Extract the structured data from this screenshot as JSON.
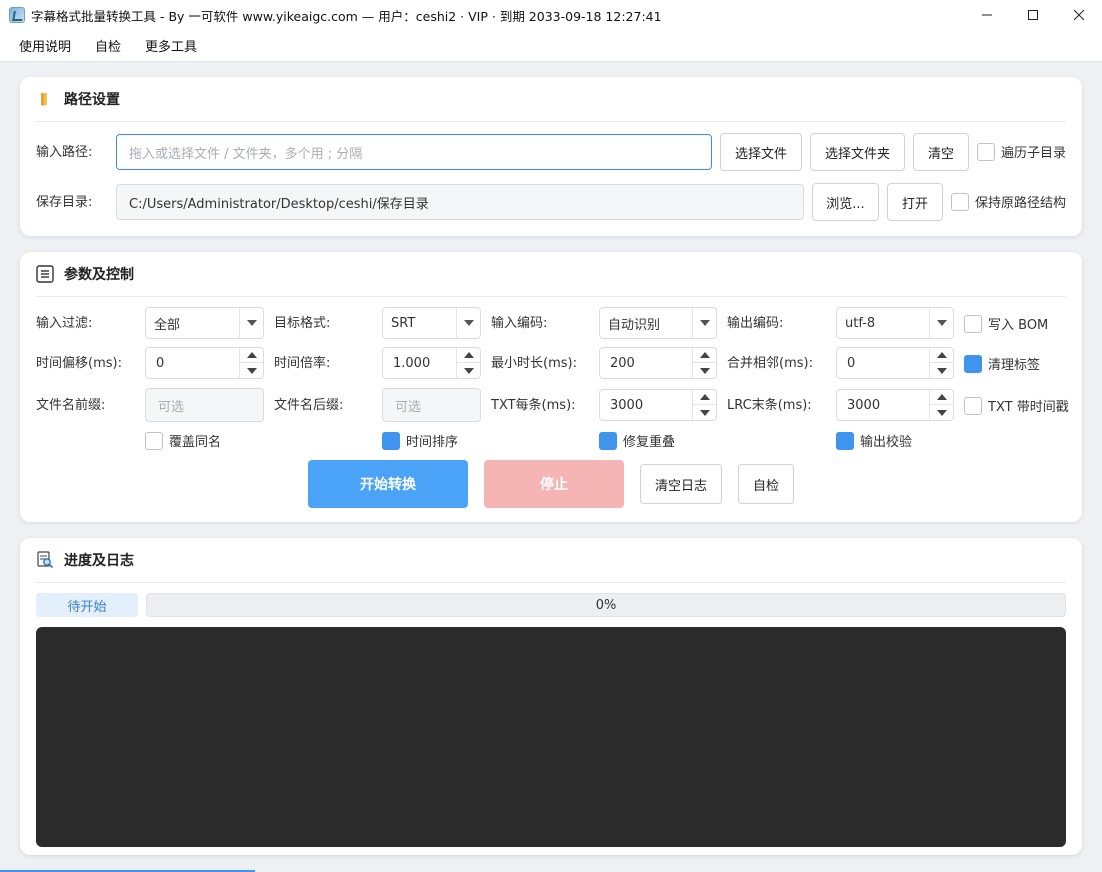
{
  "window": {
    "title": "字幕格式批量转换工具 - By 一可软件 www.yikeaigc.com  —  用户：ceshi2 · VIP · 到期 2033-09-18 12:27:41"
  },
  "menu": {
    "items": [
      "使用说明",
      "自检",
      "更多工具"
    ]
  },
  "path_panel": {
    "title": "路径设置",
    "input_label": "输入路径:",
    "input_placeholder": "拖入或选择文件 / 文件夹，多个用 ; 分隔",
    "select_file": "选择文件",
    "select_folder": "选择文件夹",
    "clear": "清空",
    "recursive_label": "遍历子目录",
    "recursive_checked": false,
    "save_label": "保存目录:",
    "save_value": "C:/Users/Administrator/Desktop/ceshi/保存目录",
    "browse": "浏览...",
    "open": "打开",
    "keep_structure_label": "保持原路径结构",
    "keep_structure_checked": false
  },
  "params_panel": {
    "title": "参数及控制",
    "input_filter_label": "输入过滤:",
    "input_filter_value": "全部",
    "target_format_label": "目标格式:",
    "target_format_value": "SRT",
    "input_encoding_label": "输入编码:",
    "input_encoding_value": "自动识别",
    "output_encoding_label": "输出编码:",
    "output_encoding_value": "utf-8",
    "write_bom_label": "写入 BOM",
    "write_bom_checked": false,
    "time_offset_label": "时间偏移(ms):",
    "time_offset_value": "0",
    "time_scale_label": "时间倍率:",
    "time_scale_value": "1.000",
    "min_duration_label": "最小时长(ms):",
    "min_duration_value": "200",
    "merge_adjacent_label": "合并相邻(ms):",
    "merge_adjacent_value": "0",
    "clean_tags_label": "清理标签",
    "clean_tags_checked": true,
    "prefix_label": "文件名前缀:",
    "prefix_placeholder": "可选",
    "suffix_label": "文件名后缀:",
    "suffix_placeholder": "可选",
    "txt_per_label": "TXT每条(ms):",
    "txt_per_value": "3000",
    "lrc_last_label": "LRC末条(ms):",
    "lrc_last_value": "3000",
    "txt_timestamp_label": "TXT 带时间戳",
    "txt_timestamp_checked": false,
    "overwrite_label": "覆盖同名",
    "overwrite_checked": false,
    "sort_time_label": "时间排序",
    "sort_time_checked": true,
    "fix_overlap_label": "修复重叠",
    "fix_overlap_checked": true,
    "output_check_label": "输出校验",
    "output_check_checked": true,
    "start_button": "开始转换",
    "stop_button": "停止",
    "clear_log_button": "清空日志",
    "self_check_button": "自检"
  },
  "log_panel": {
    "title": "进度及日志",
    "status": "待开始",
    "progress_text": "0%",
    "progress_percent": 0
  },
  "colors": {
    "accent": "#3f95ee",
    "start_button": "#4aa3f7",
    "stop_button": "#f6b5b5",
    "log_background": "#2b2b2b"
  }
}
